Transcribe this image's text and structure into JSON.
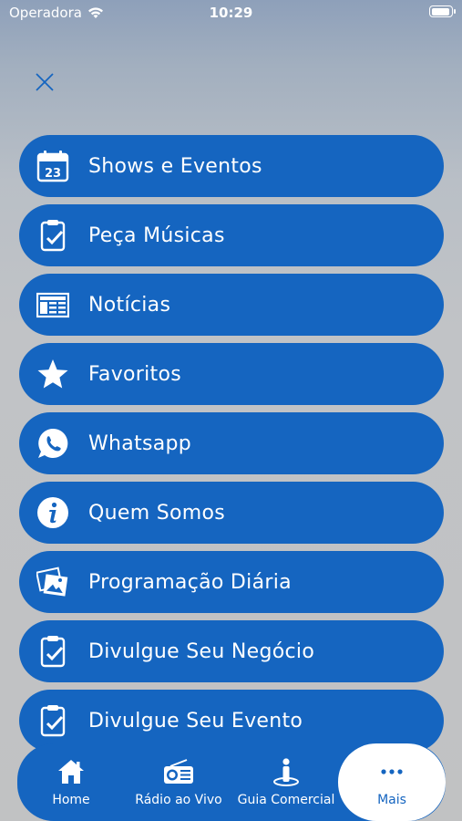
{
  "status_bar": {
    "carrier": "Operadora",
    "time": "10:29"
  },
  "menu": {
    "items": [
      {
        "label": "Shows e Eventos",
        "icon": "calendar-icon",
        "calendar_day": "23"
      },
      {
        "label": "Peça Músicas",
        "icon": "clipboard-check-icon"
      },
      {
        "label": "Notícias",
        "icon": "newspaper-icon"
      },
      {
        "label": "Favoritos",
        "icon": "star-icon"
      },
      {
        "label": "Whatsapp",
        "icon": "whatsapp-icon"
      },
      {
        "label": "Quem Somos",
        "icon": "info-icon"
      },
      {
        "label": "Programação Diária",
        "icon": "photos-icon"
      },
      {
        "label": "Divulgue Seu Negócio",
        "icon": "clipboard-check-icon"
      },
      {
        "label": "Divulgue Seu Evento",
        "icon": "clipboard-check-icon"
      }
    ]
  },
  "tab_bar": {
    "tabs": [
      {
        "label": "Home",
        "icon": "home-icon"
      },
      {
        "label": "Rádio ao Vivo",
        "icon": "radio-icon"
      },
      {
        "label": "Guia Comercial",
        "icon": "guide-icon"
      },
      {
        "label": "Mais",
        "icon": "more-icon",
        "active": true
      }
    ]
  },
  "colors": {
    "accent": "#1565c0",
    "close_icon": "#1565c0"
  }
}
